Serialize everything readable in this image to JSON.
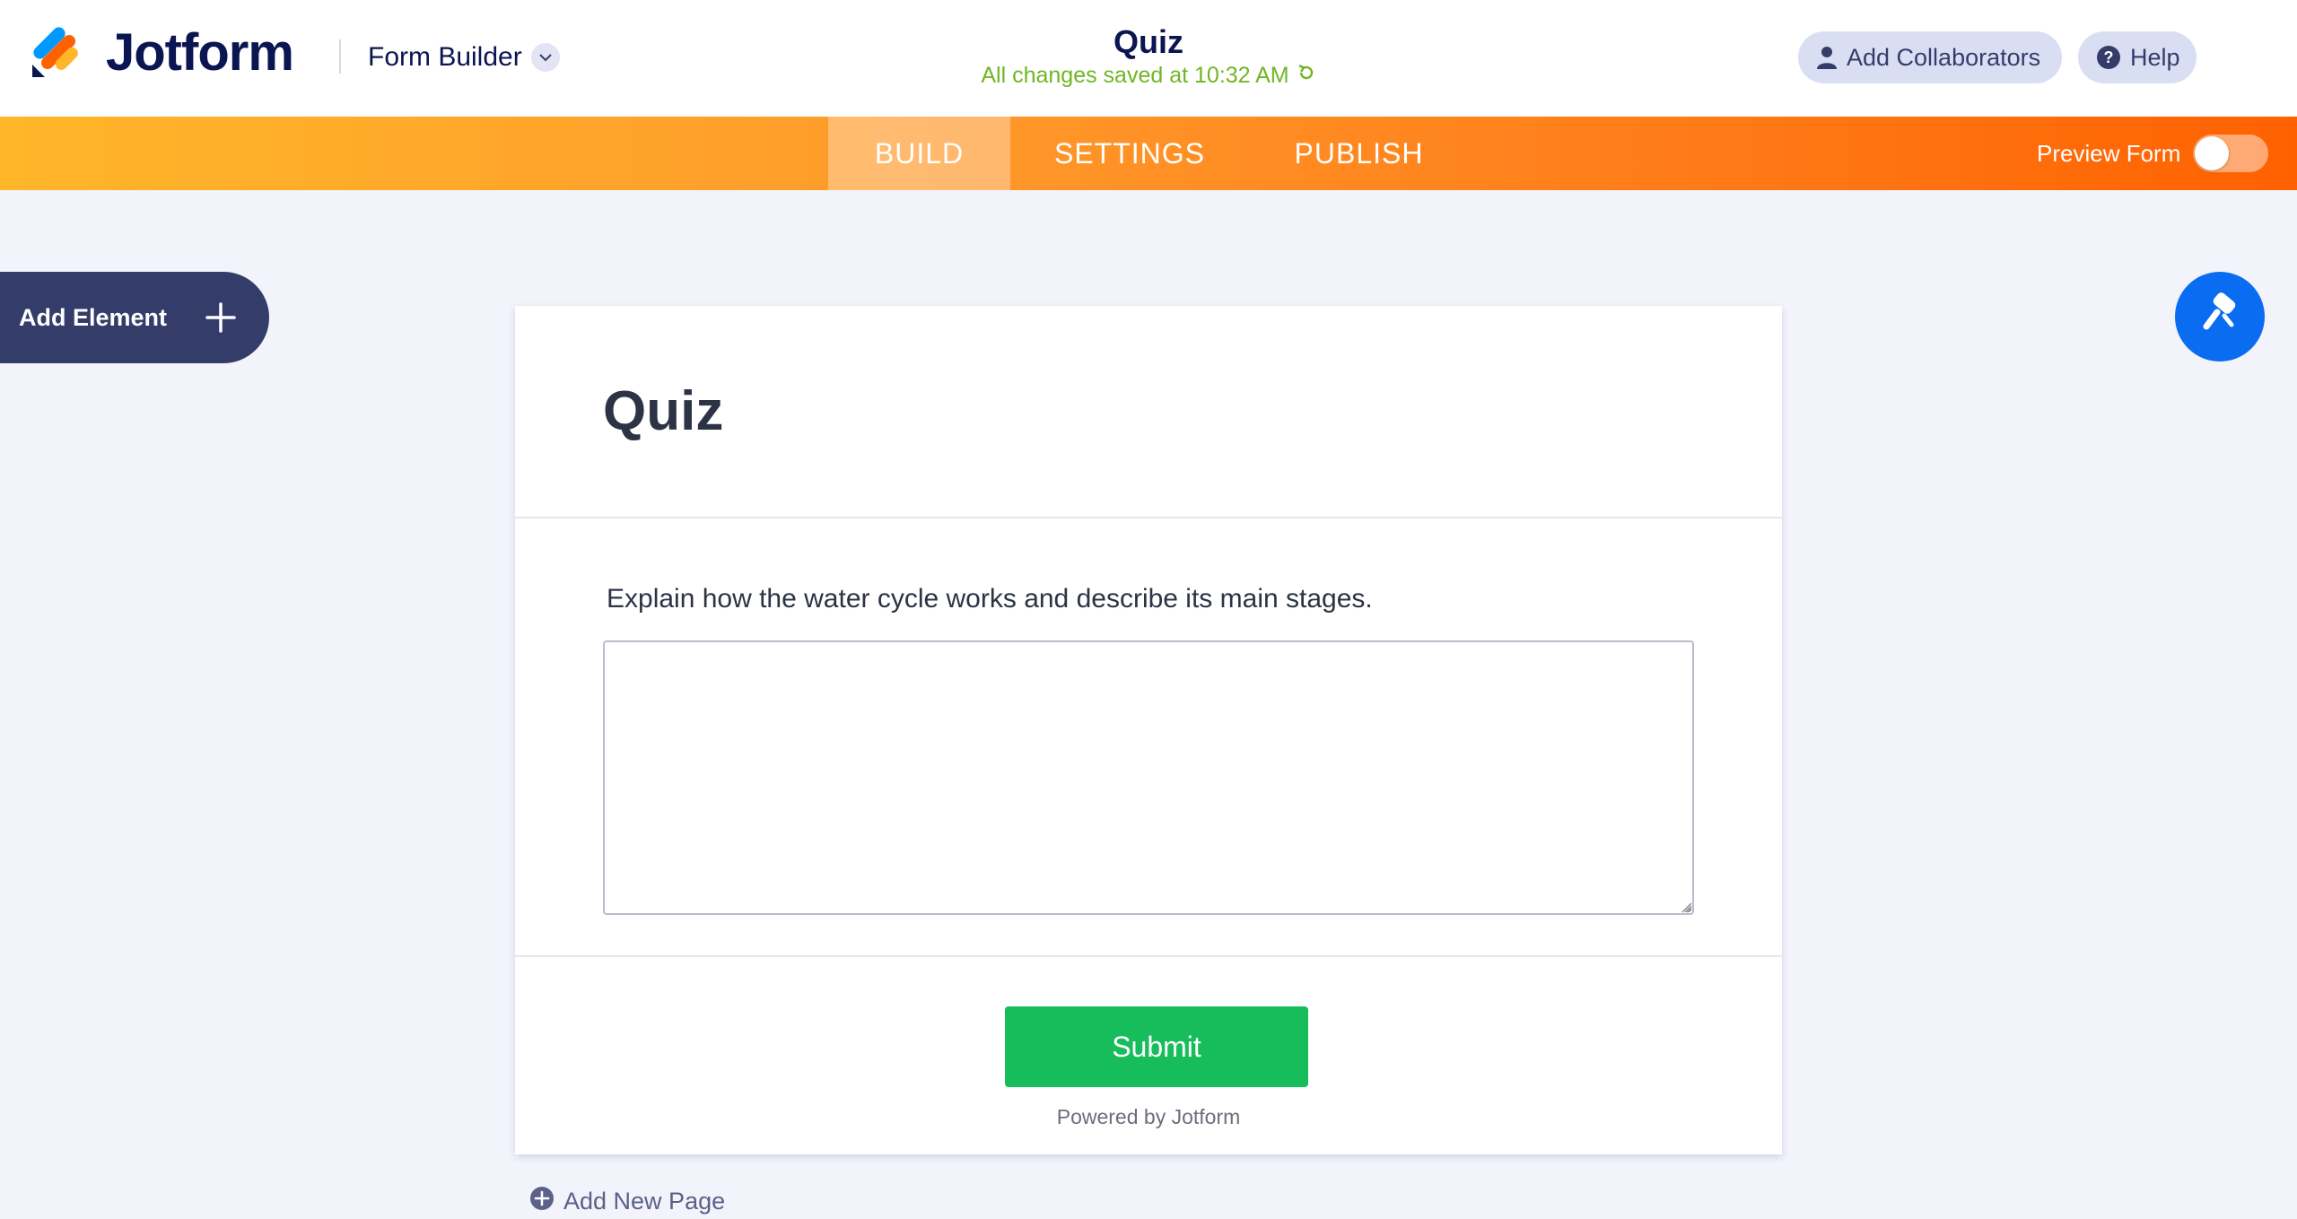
{
  "header": {
    "brand": "Jotform",
    "builder_menu": "Form Builder",
    "form_title": "Quiz",
    "save_status": "All changes saved at 10:32 AM",
    "add_collaborators": "Add Collaborators",
    "help": "Help"
  },
  "nav": {
    "tabs": [
      {
        "label": "BUILD",
        "active": true
      },
      {
        "label": "SETTINGS",
        "active": false
      },
      {
        "label": "PUBLISH",
        "active": false
      }
    ],
    "preview_label": "Preview Form",
    "preview_enabled": false
  },
  "sidebar": {
    "add_element": "Add Element"
  },
  "form": {
    "title": "Quiz",
    "question": "Explain how the water cycle works and describe its main stages.",
    "answer_value": "",
    "submit_label": "Submit",
    "powered_by": "Powered by Jotform"
  },
  "footer": {
    "add_page": "Add New Page"
  },
  "colors": {
    "brand_navy": "#0a1551",
    "nav_orange_start": "#ffb629",
    "nav_orange_end": "#ff6100",
    "save_green": "#6fb624",
    "submit_green": "#18bd5b",
    "designer_blue": "#0a6cf0",
    "sidebar_dark": "#343c6a"
  },
  "icons": {
    "logo": "jotform-logo-icon",
    "builder_chevron": "chevron-down-icon",
    "refresh": "refresh-icon",
    "collaborator": "user-icon",
    "help": "question-circle-icon",
    "add_element": "plus-icon",
    "designer": "paint-roller-icon",
    "add_page": "plus-circle-icon"
  }
}
